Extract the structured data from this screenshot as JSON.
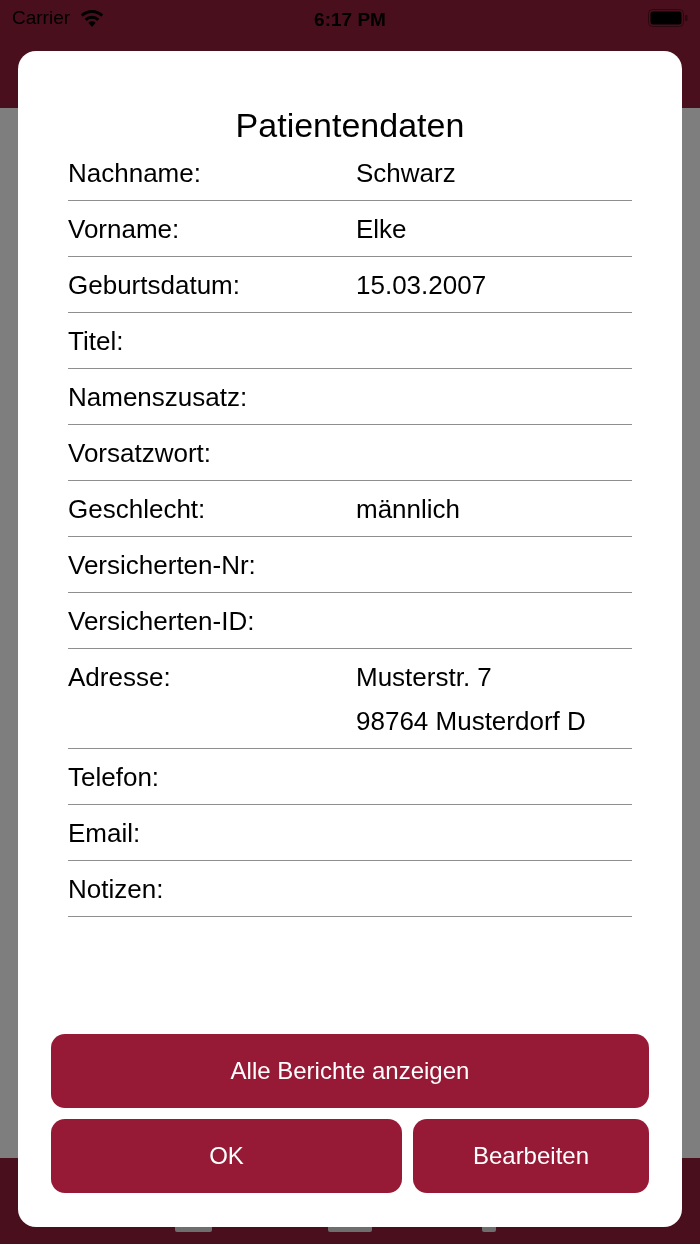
{
  "status_bar": {
    "carrier": "Carrier",
    "time": "6:17 PM"
  },
  "dialog": {
    "title": "Patientendaten",
    "fields": [
      {
        "label": "Nachname:",
        "value": "Schwarz"
      },
      {
        "label": "Vorname:",
        "value": "Elke"
      },
      {
        "label": "Geburtsdatum:",
        "value": "15.03.2007"
      },
      {
        "label": "Titel:"
      },
      {
        "label": "Namenszusatz:"
      },
      {
        "label": "Vorsatzwort:"
      },
      {
        "label": "Geschlecht:",
        "value": "männlich"
      },
      {
        "label": "Versicherten-Nr:"
      },
      {
        "label": "Versicherten-ID:"
      },
      {
        "label": "Adresse:",
        "value": "Musterstr. 7\n98764 Musterdorf D"
      },
      {
        "label": "Telefon:"
      },
      {
        "label": "Email:"
      },
      {
        "label": "Notizen:"
      }
    ],
    "button_rows": [
      [
        {
          "label": "Alle Berichte anzeigen"
        }
      ],
      [
        {
          "label": "OK"
        },
        {
          "label": "Bearbeiten"
        }
      ]
    ]
  }
}
